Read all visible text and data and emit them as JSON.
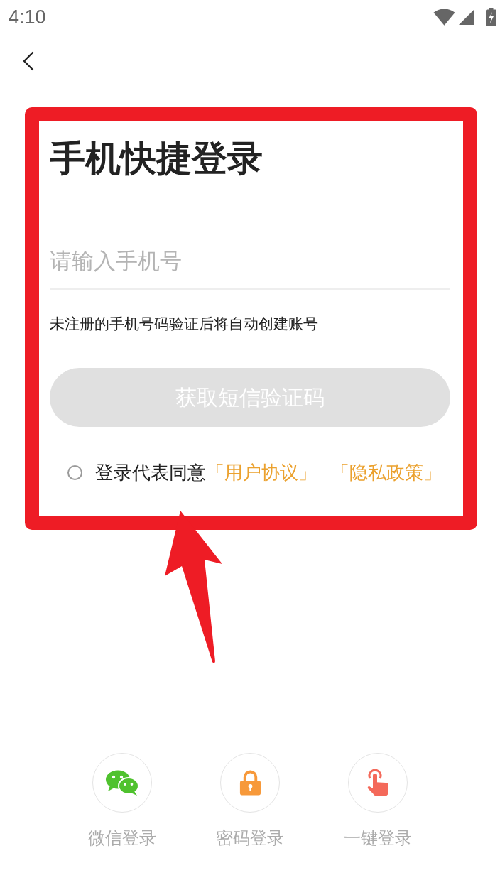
{
  "status_bar": {
    "time": "4:10"
  },
  "login_form": {
    "title": "手机快捷登录",
    "phone_field": {
      "placeholder": "请输入手机号"
    },
    "hint": "未注册的手机号码验证后将自动创建账号",
    "submit_button": {
      "label": "获取短信验证码",
      "disabled": true
    },
    "agreement": {
      "checked": false,
      "text": "登录代表同意",
      "links": [
        "「用户协议」",
        "「隐私政策」"
      ]
    }
  },
  "other_logins": [
    {
      "kind": "wechat",
      "label": "微信登录"
    },
    {
      "kind": "password",
      "label": "密码登录"
    },
    {
      "kind": "one_tap",
      "label": "一键登录"
    }
  ],
  "annotation": {
    "highlight_frame": true,
    "arrow": true
  }
}
